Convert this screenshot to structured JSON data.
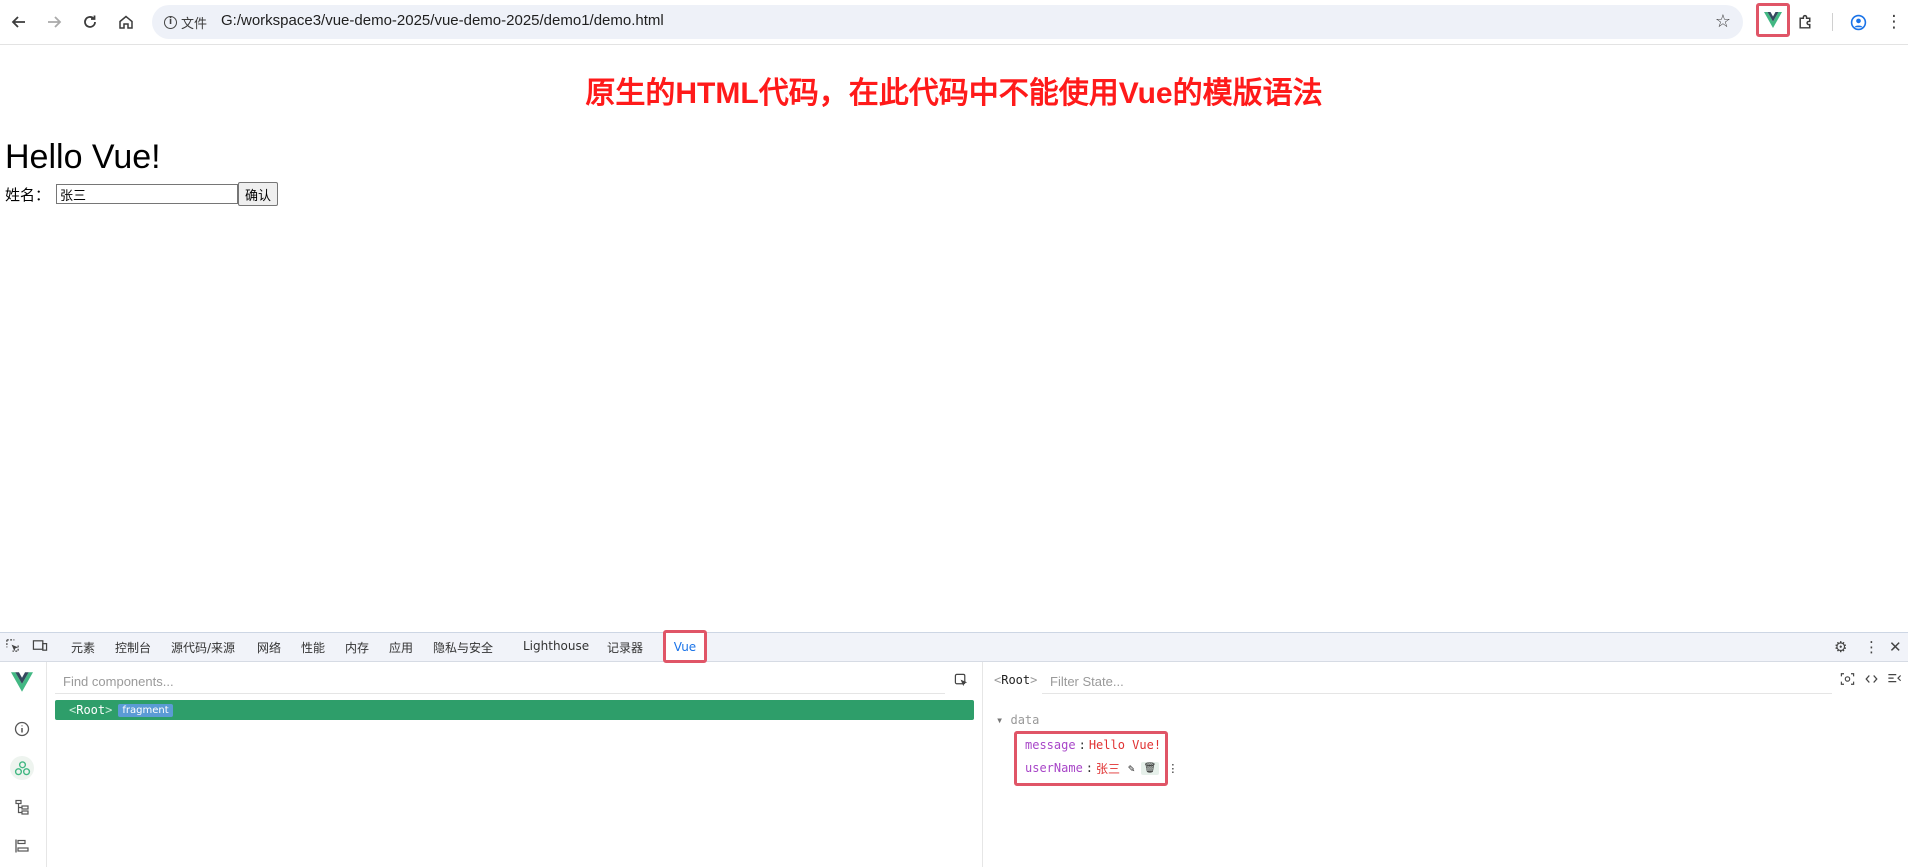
{
  "browser": {
    "site_info_label": "文件",
    "url": "G:/workspace3/vue-demo-2025/vue-demo-2025/demo1/demo.html"
  },
  "page": {
    "annotation": "原生的HTML代码，在此代码中不能使用Vue的模版语法",
    "heading": "Hello Vue!",
    "name_label": "姓名：",
    "name_value": "张三",
    "confirm_label": "确认"
  },
  "devtools": {
    "tabs": [
      "元素",
      "控制台",
      "源代码/来源",
      "网络",
      "性能",
      "内存",
      "应用",
      "隐私与安全",
      "Lighthouse",
      "记录器"
    ],
    "active_tab": "Vue",
    "vue": {
      "find_placeholder": "Find components...",
      "root_name": "Root",
      "fragment_badge": "fragment",
      "filter_placeholder": "Filter State...",
      "selected_root": "Root",
      "data_section": "data",
      "props": [
        {
          "key": "message",
          "value": "Hello Vue!"
        },
        {
          "key": "userName",
          "value": "张三"
        }
      ]
    }
  },
  "colors": {
    "vue_green": "#42b883",
    "annotation_red": "#ff1a1a",
    "highlight_box": "#e05567",
    "selected_row": "#2e9e6a"
  }
}
